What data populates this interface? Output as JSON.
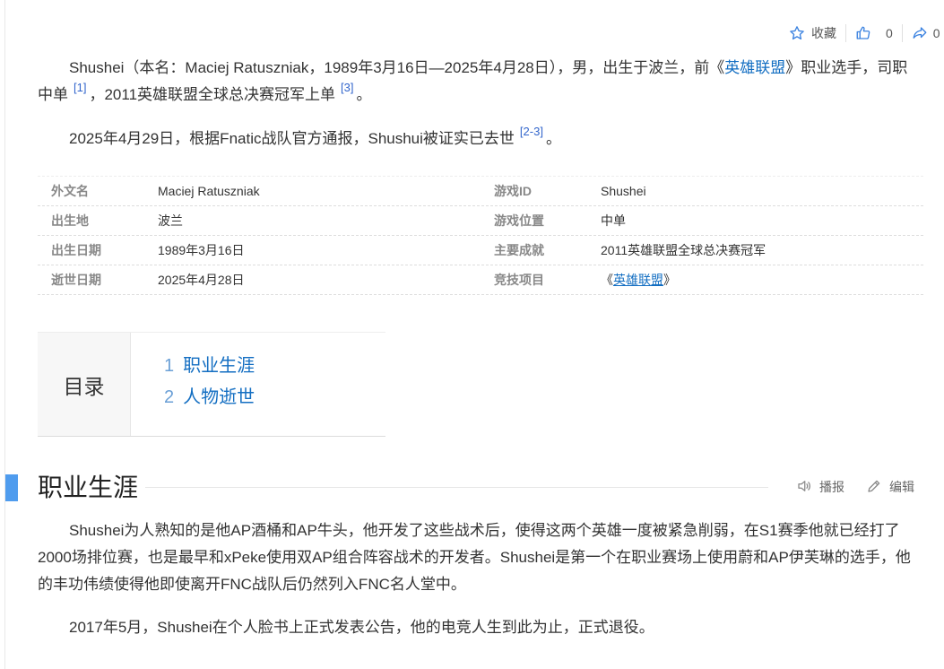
{
  "actions": {
    "favorite_icon": "star-icon",
    "favorite_label": "收藏",
    "like_icon": "thumbs-up-icon",
    "like_count": "0",
    "share_icon": "share-icon",
    "share_count": "0"
  },
  "intro": {
    "p1": {
      "text_a": "Shushei（本名：Maciej Ratuszniak，1989年3月16日—2025年4月28日），男，出生于波兰，前《",
      "link": "英雄联盟",
      "text_b": "》职业选手，司职中单",
      "ref1": "[1]",
      "text_c": "，2011英雄联盟全球总决赛冠军上单",
      "ref2": "[3]",
      "text_d": "。"
    },
    "p2": {
      "text_a": "2025年4月29日，根据Fnatic战队官方通报，Shushui被证实已去世",
      "ref": "[2-3]",
      "text_b": "。"
    }
  },
  "infobox": [
    {
      "k1": "外文名",
      "v1": "Maciej Ratuszniak",
      "k2": "游戏ID",
      "v2": "Shushei"
    },
    {
      "k1": "出生地",
      "v1": "波兰",
      "k2": "游戏位置",
      "v2": "中单"
    },
    {
      "k1": "出生日期",
      "v1": "1989年3月16日",
      "k2": "主要成就",
      "v2": "2011英雄联盟全球总决赛冠军"
    },
    {
      "k1": "逝世日期",
      "v1": "2025年4月28日",
      "k2": "竞技项目",
      "v2_pre": "《",
      "v2_link": "英雄联盟",
      "v2_post": "》"
    }
  ],
  "toc": {
    "title": "目录",
    "items": [
      {
        "num": "1",
        "label": "职业生涯"
      },
      {
        "num": "2",
        "label": "人物逝世"
      }
    ]
  },
  "section": {
    "title": "职业生涯",
    "broadcast_icon": "speaker-icon",
    "broadcast_label": "播报",
    "edit_icon": "pencil-icon",
    "edit_label": "编辑"
  },
  "career": {
    "p1": "Shushei为人熟知的是他AP酒桶和AP牛头，他开发了这些战术后，使得这两个英雄一度被紧急削弱，在S1赛季他就已经打了2000场排位赛，也是最早和xPeke使用双AP组合阵容战术的开发者。Shushei是第一个在职业赛场上使用蔚和AP伊芙琳的选手，他的丰功伟绩使得他即使离开FNC战队后仍然列入FNC名人堂中。",
    "p2": "2017年5月，Shushei在个人脸书上正式发表公告，他的电竞人生到此为止，正式退役。"
  },
  "colors": {
    "link": "#136ec2",
    "accent_bar": "#4f9cee",
    "label_gray": "#888888"
  }
}
